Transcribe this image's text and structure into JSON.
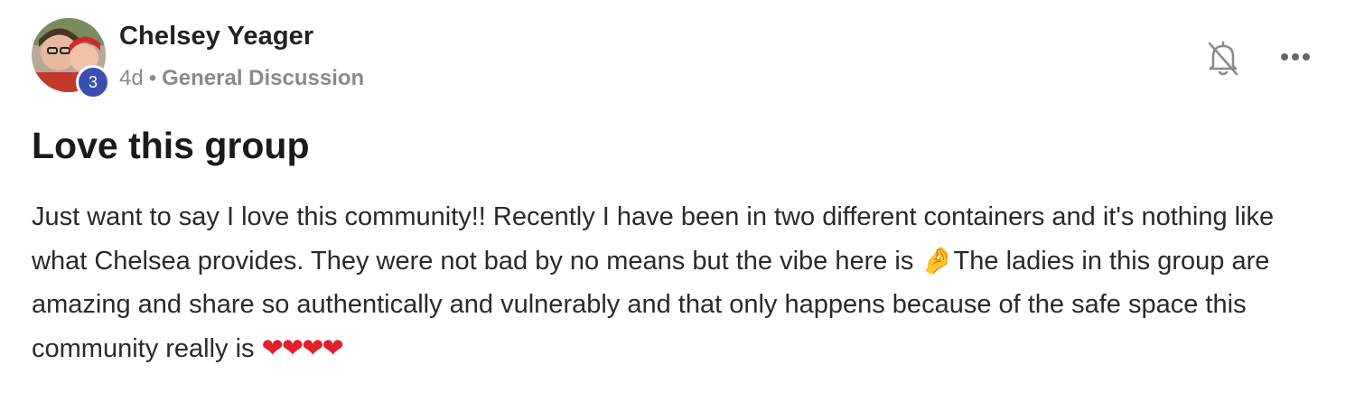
{
  "author": {
    "name": "Chelsey Yeager",
    "level": "3"
  },
  "meta": {
    "time": "4d",
    "separator": "•",
    "category": "General Discussion"
  },
  "post": {
    "title": "Love this group",
    "body_part1": "Just want to say I love this community!! Recently I have been in two different containers and it's nothing like what Chelsea provides. They were not bad by no means but the vibe here is ",
    "emoji_hand": "🤌",
    "body_part2": "The ladies in this group are amazing and share so authentically and vulnerably and that only happens because of the safe space this community really is ",
    "emoji_hearts": "❤❤❤❤"
  },
  "actions": {
    "notify_icon": "bell-muted-icon",
    "more_icon": "more-dots-icon"
  },
  "colors": {
    "level_badge": "#3a4fb2",
    "meta_text": "#8a8a8a",
    "heart": "#e0202a"
  }
}
